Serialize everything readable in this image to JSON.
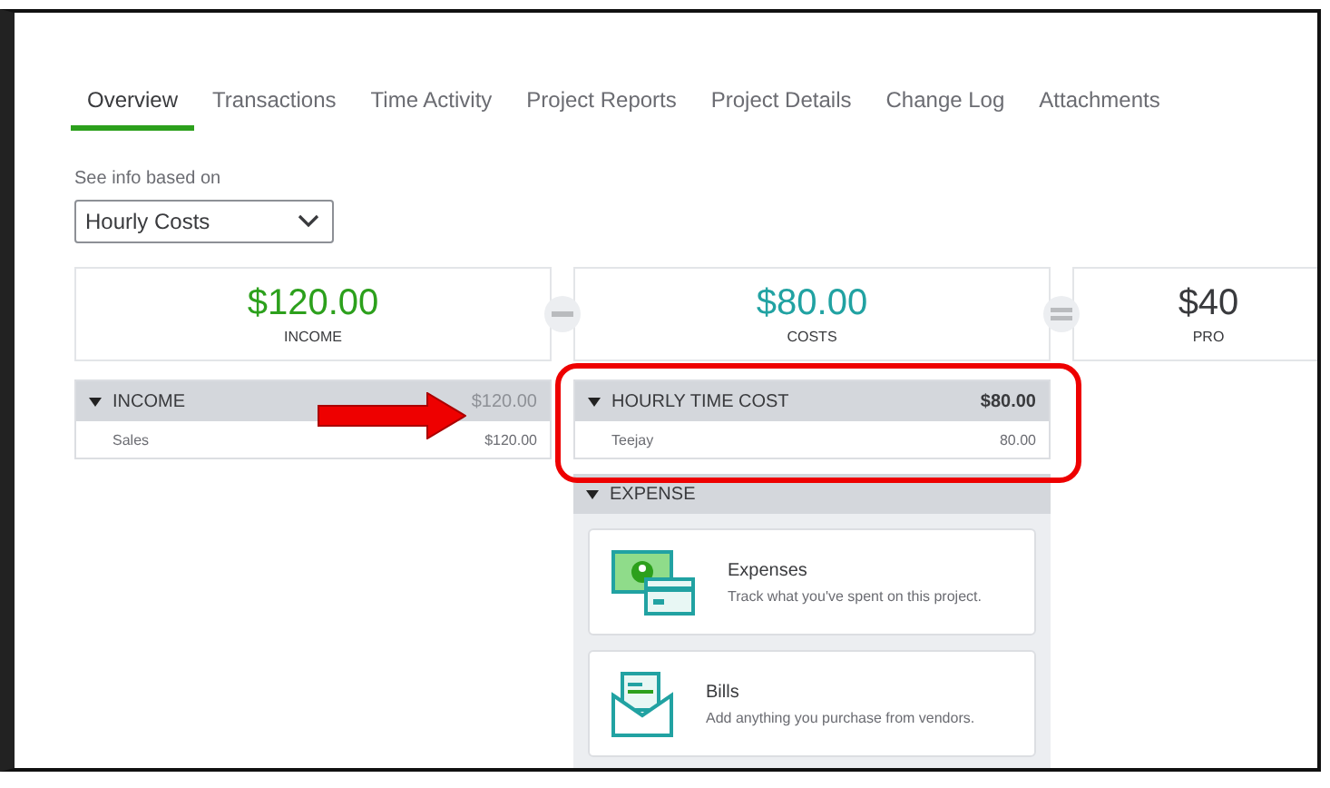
{
  "tabs": [
    {
      "label": "Overview",
      "selected": true
    },
    {
      "label": "Transactions",
      "selected": false
    },
    {
      "label": "Time Activity",
      "selected": false
    },
    {
      "label": "Project Reports",
      "selected": false
    },
    {
      "label": "Project Details",
      "selected": false
    },
    {
      "label": "Change Log",
      "selected": false
    },
    {
      "label": "Attachments",
      "selected": false
    }
  ],
  "view_selector": {
    "label": "See info based on",
    "value": "Hourly Costs"
  },
  "summary": [
    {
      "amount": "$120.00",
      "caption": "INCOME",
      "kind": "income"
    },
    {
      "kind": "minus"
    },
    {
      "amount": "$80.00",
      "caption": "COSTS",
      "kind": "costs"
    },
    {
      "kind": "equals"
    },
    {
      "amount": "$40",
      "caption": "PRO",
      "kind": "profit"
    }
  ],
  "income_section": {
    "title": "INCOME",
    "total": "$120.00",
    "expanded": true,
    "rows": [
      {
        "name": "Sales",
        "amount": "$120.00"
      }
    ]
  },
  "cost_section": {
    "title": "HOURLY TIME COST",
    "total": "$80.00",
    "expanded": true,
    "rows": [
      {
        "name": "Teejay",
        "amount": "80.00"
      }
    ]
  },
  "expense_section": {
    "title": "EXPENSE",
    "expanded": true,
    "items": [
      {
        "title": "Expenses",
        "description": "Track what you've spent on this project.",
        "kind": "money"
      },
      {
        "title": "Bills",
        "description": "Add anything you purchase from vendors.",
        "kind": "envelope"
      }
    ]
  }
}
